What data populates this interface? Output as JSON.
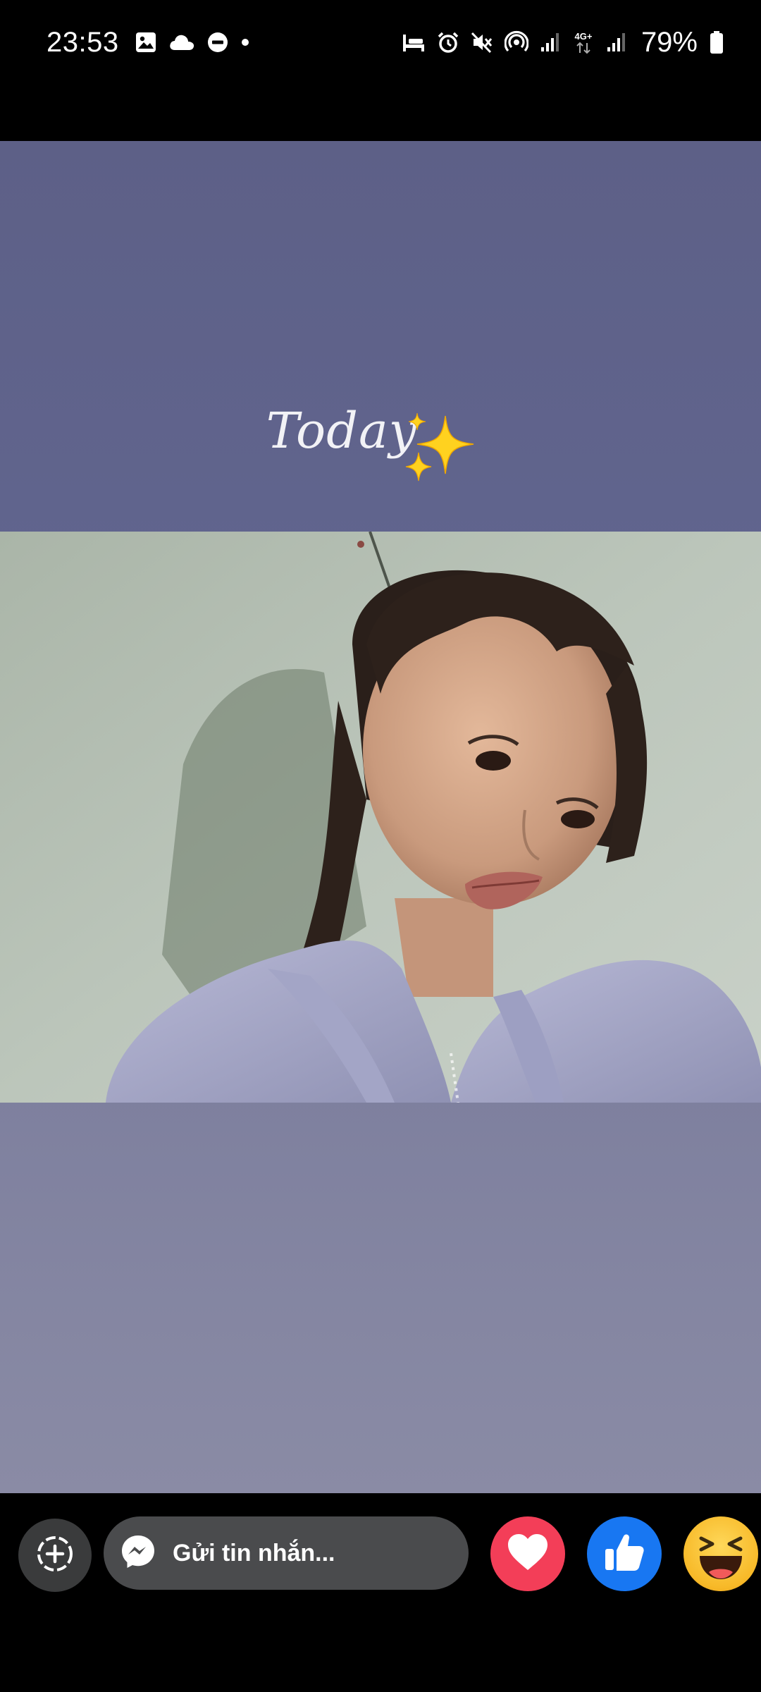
{
  "status_bar": {
    "time": "23:53",
    "battery_percent": "79%",
    "network_label": "4G+",
    "left_icons": [
      "gallery-icon",
      "cloud-icon",
      "do-not-disturb-icon",
      "dot-icon"
    ],
    "right_icons": [
      "sleep-mode-icon",
      "alarm-icon",
      "mute-icon",
      "hotspot-icon",
      "signal-icon",
      "signal-icon",
      "battery-icon"
    ]
  },
  "story": {
    "caption": "Today",
    "caption_emoji": "sparkles-icon",
    "background_color": "#5d6087",
    "photo": "selfie-photo"
  },
  "reply_bar": {
    "message_placeholder": "Gửi tin nhắn...",
    "add_icon": "add-reply-icon",
    "messenger_icon": "messenger-icon",
    "reactions": [
      {
        "name": "love",
        "icon": "heart-icon",
        "color": "#f33e58"
      },
      {
        "name": "like",
        "icon": "thumbs-up-icon",
        "color": "#1877f2"
      },
      {
        "name": "haha",
        "icon": "laughing-face-icon",
        "color": "#f7b928"
      }
    ]
  }
}
